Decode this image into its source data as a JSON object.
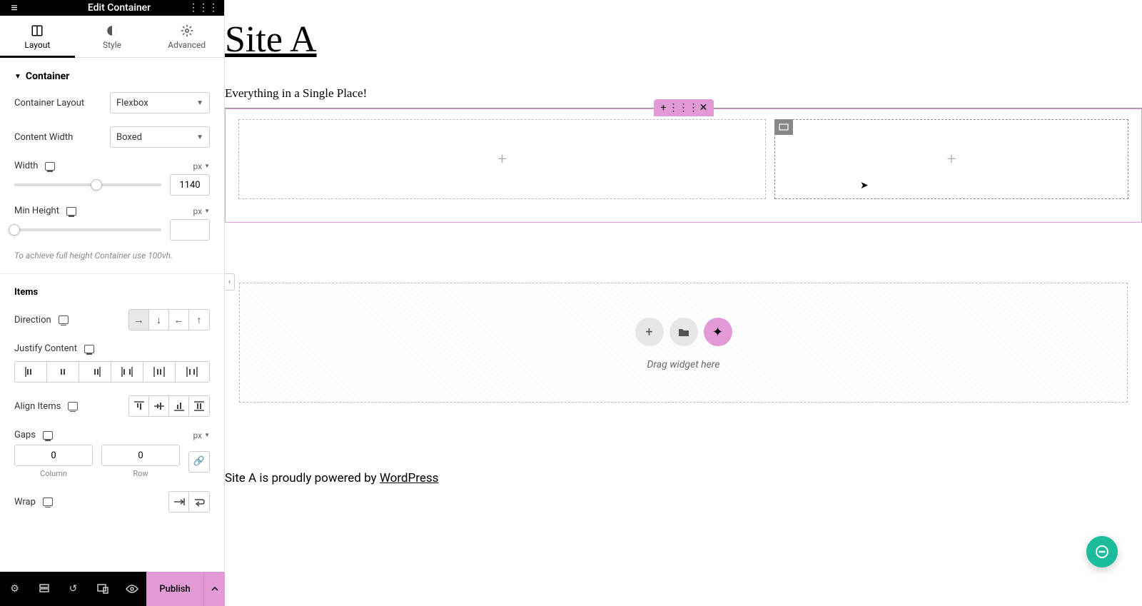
{
  "panel": {
    "title": "Edit Container",
    "tabs": {
      "layout": "Layout",
      "style": "Style",
      "advanced": "Advanced"
    },
    "section_container": "Container",
    "container_layout": {
      "label": "Container Layout",
      "value": "Flexbox"
    },
    "content_width": {
      "label": "Content Width",
      "value": "Boxed"
    },
    "width": {
      "label": "Width",
      "unit": "px",
      "value": "1140"
    },
    "min_height": {
      "label": "Min Height",
      "unit": "px",
      "value": ""
    },
    "hint": "To achieve full height Container use 100vh.",
    "section_items": "Items",
    "direction": {
      "label": "Direction"
    },
    "justify": {
      "label": "Justify Content"
    },
    "align": {
      "label": "Align Items"
    },
    "gaps": {
      "label": "Gaps",
      "unit": "px",
      "column": "0",
      "row": "0",
      "column_label": "Column",
      "row_label": "Row"
    },
    "wrap": {
      "label": "Wrap"
    }
  },
  "bottom": {
    "publish": "Publish"
  },
  "canvas": {
    "site_title": "Site A",
    "tagline": "Everything in a Single Place!",
    "drag_hint": "Drag widget here",
    "footer_prefix": "Site A is proudly powered by ",
    "footer_link": "WordPress"
  }
}
